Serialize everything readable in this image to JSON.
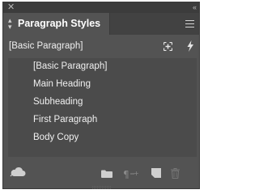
{
  "panel": {
    "title": "Paragraph Styles",
    "close_glyph": "✕",
    "collapse_glyph": "‹‹"
  },
  "current_style": {
    "label": "[Basic Paragraph]"
  },
  "styles": [
    {
      "label": "[Basic Paragraph]"
    },
    {
      "label": "Main Heading"
    },
    {
      "label": "Subheading"
    },
    {
      "label": "First Paragraph"
    },
    {
      "label": "Body Copy"
    }
  ],
  "bottom_bar": {
    "icons": [
      "cc-libraries-icon",
      "new-group-folder-icon",
      "clear-overrides-icon",
      "new-style-icon",
      "delete-icon"
    ]
  },
  "colors": {
    "panel_bg": "#535353",
    "list_bg": "#4b4b4b",
    "tabbar_bg": "#424242",
    "titlebar_bg": "#3c3c3c",
    "text": "#f0f0f0"
  }
}
